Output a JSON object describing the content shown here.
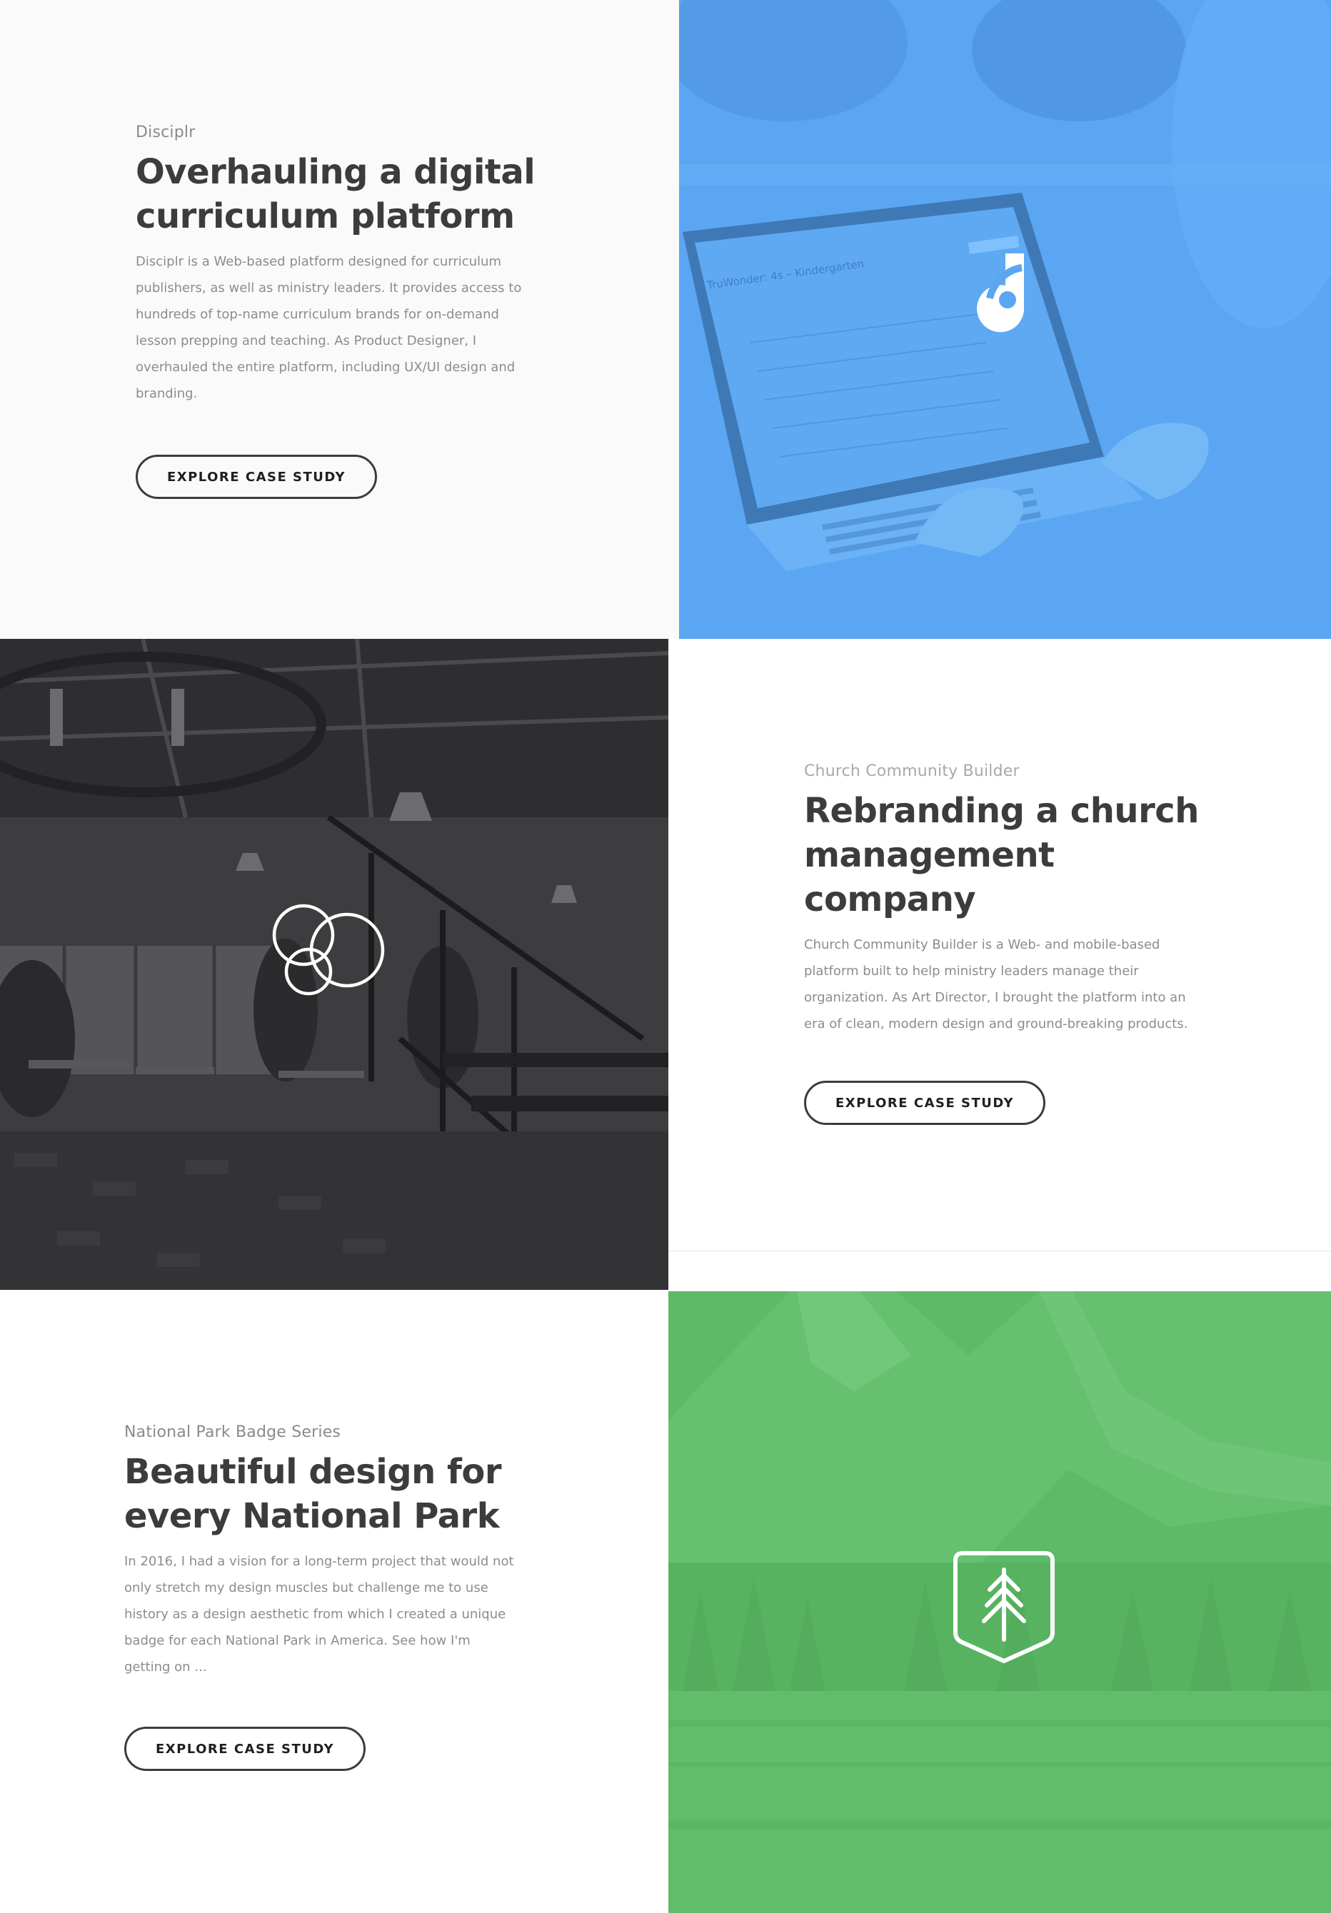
{
  "projects": [
    {
      "eyebrow": "Disciplr",
      "title_line1": "Overhauling a digital",
      "title_line2": "curriculum platform",
      "desc_lines": [
        "Disciplr is a Web-based platform designed for curriculum",
        "publishers, as well as ministry leaders. It provides access to",
        "hundreds of top-name curriculum brands for on-demand",
        "lesson prepping and teaching. As Product Designer, I",
        "overhauled the entire platform, including UX/UI design and",
        "branding."
      ],
      "cta": "EXPLORE CASE STUDY",
      "image_icon": "disciplr-logo-icon",
      "image_color": "#5aa6f3",
      "screen_title": "TruWonder: 4s – Kindergarten"
    },
    {
      "eyebrow": "Church Community Builder",
      "title_line1": "Rebranding a church",
      "title_line2": "management",
      "title_line3": "company",
      "desc_lines": [
        "Church Community Builder is a Web- and mobile-based",
        "platform built to help ministry leaders manage their",
        "organization. As Art Director, I brought the platform into an",
        "era of clean, modern design and ground-breaking products."
      ],
      "cta": "EXPLORE CASE STUDY",
      "image_icon": "circles-logo-icon",
      "image_color": "#3a3a3c"
    },
    {
      "eyebrow": "National Park Badge Series",
      "title_line1": "Beautiful design for",
      "title_line2": "every National Park",
      "desc_lines": [
        "In 2016, I had a vision for a long-term project that would not",
        "only stretch my design muscles but challenge me to use",
        "history as a design aesthetic from which I created a unique",
        "badge for each National Park in America. See how I'm",
        "getting on ..."
      ],
      "cta": "EXPLORE CASE STUDY",
      "image_icon": "tree-badge-icon",
      "image_color": "#5dba66"
    }
  ]
}
